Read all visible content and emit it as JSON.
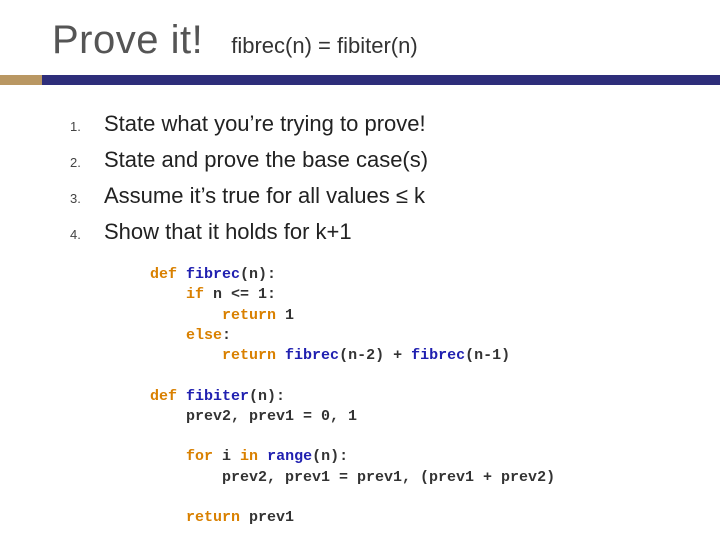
{
  "header": {
    "title": "Prove it!",
    "subtitle": "fibrec(n) = fibiter(n)"
  },
  "steps": [
    {
      "num": "1.",
      "text": "State what you’re trying to prove!"
    },
    {
      "num": "2.",
      "text": "State and prove the base case(s)"
    },
    {
      "num": "3.",
      "text": "Assume it’s true for all values ≤ k"
    },
    {
      "num": "4.",
      "text": "Show that it holds for k+1"
    }
  ],
  "code": [
    {
      "a": "def",
      "b": " ",
      "c": "fibrec",
      "d": "(n):"
    },
    {
      "a": "    ",
      "b": "if",
      "c": " n <= 1:"
    },
    {
      "a": "        ",
      "b": "return",
      "c": " 1"
    },
    {
      "a": "    ",
      "b": "else",
      "c": ":"
    },
    {
      "a": "        ",
      "b": "return",
      "c": " ",
      "d": "fibrec",
      "e": "(n-2) + ",
      "f": "fibrec",
      "g": "(n-1)"
    },
    {
      "a": " "
    },
    {
      "a": "def",
      "b": " ",
      "c": "fibiter",
      "d": "(n):"
    },
    {
      "a": "    prev2, prev1 = 0, 1"
    },
    {
      "a": " "
    },
    {
      "a": "    ",
      "b": "for",
      "c": " i ",
      "d": "in",
      "e": " ",
      "f": "range",
      "g": "(n):"
    },
    {
      "a": "        prev2, prev1 = prev1, (prev1 + prev2)"
    },
    {
      "a": " "
    },
    {
      "a": "    ",
      "b": "return",
      "c": " prev1"
    }
  ]
}
